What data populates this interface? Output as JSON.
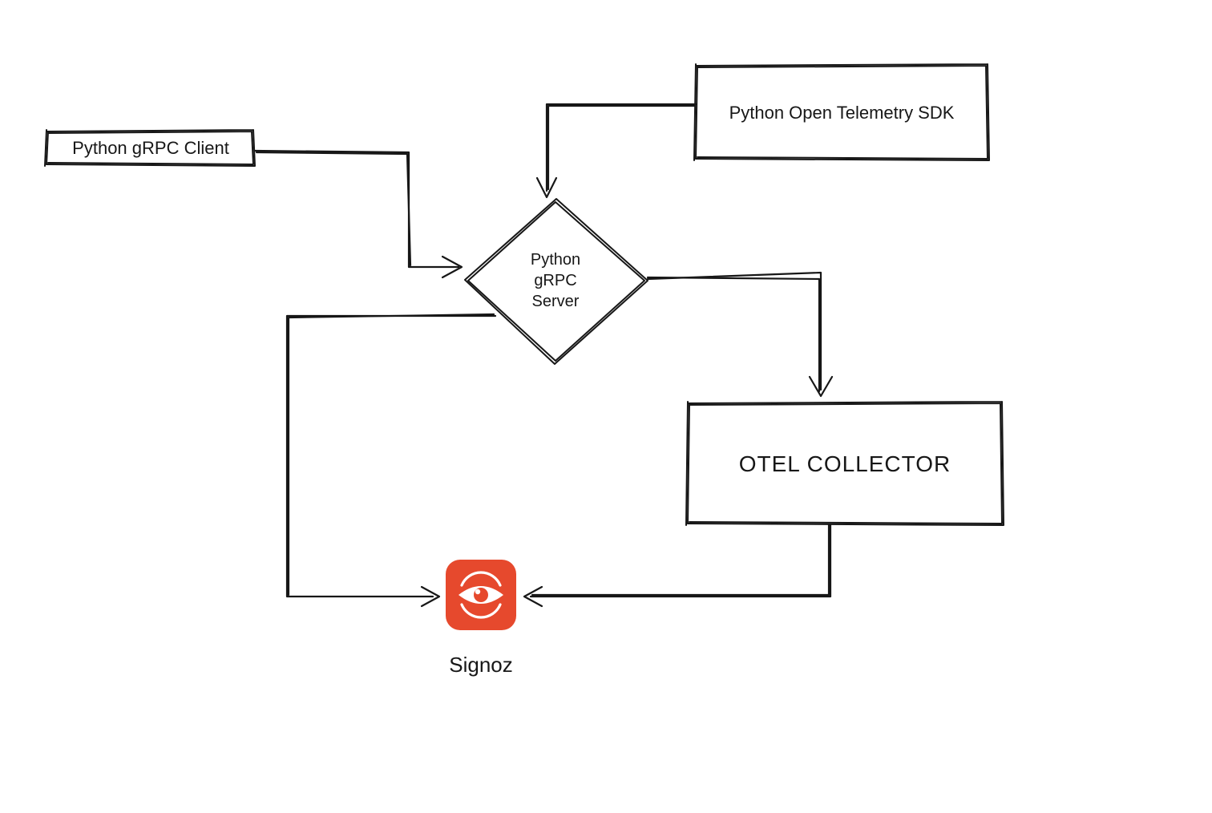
{
  "nodes": {
    "client": {
      "label": "Python gRPC Client"
    },
    "sdk": {
      "label": "Python Open Telemetry SDK"
    },
    "server": {
      "line1": "Python",
      "line2": "gRPC",
      "line3": "Server"
    },
    "collector": {
      "label": "OTEL COLLECTOR"
    },
    "signoz": {
      "label": "Signoz",
      "icon": "eye-icon",
      "icon_bg": "#E6492D",
      "icon_fg": "#ffffff"
    }
  },
  "edges": [
    {
      "from": "client",
      "to": "server"
    },
    {
      "from": "sdk",
      "to": "server"
    },
    {
      "from": "server",
      "to": "collector"
    },
    {
      "from": "server",
      "to": "signoz"
    },
    {
      "from": "collector",
      "to": "signoz"
    }
  ],
  "style": {
    "stroke": "#171717",
    "background": "#ffffff"
  }
}
